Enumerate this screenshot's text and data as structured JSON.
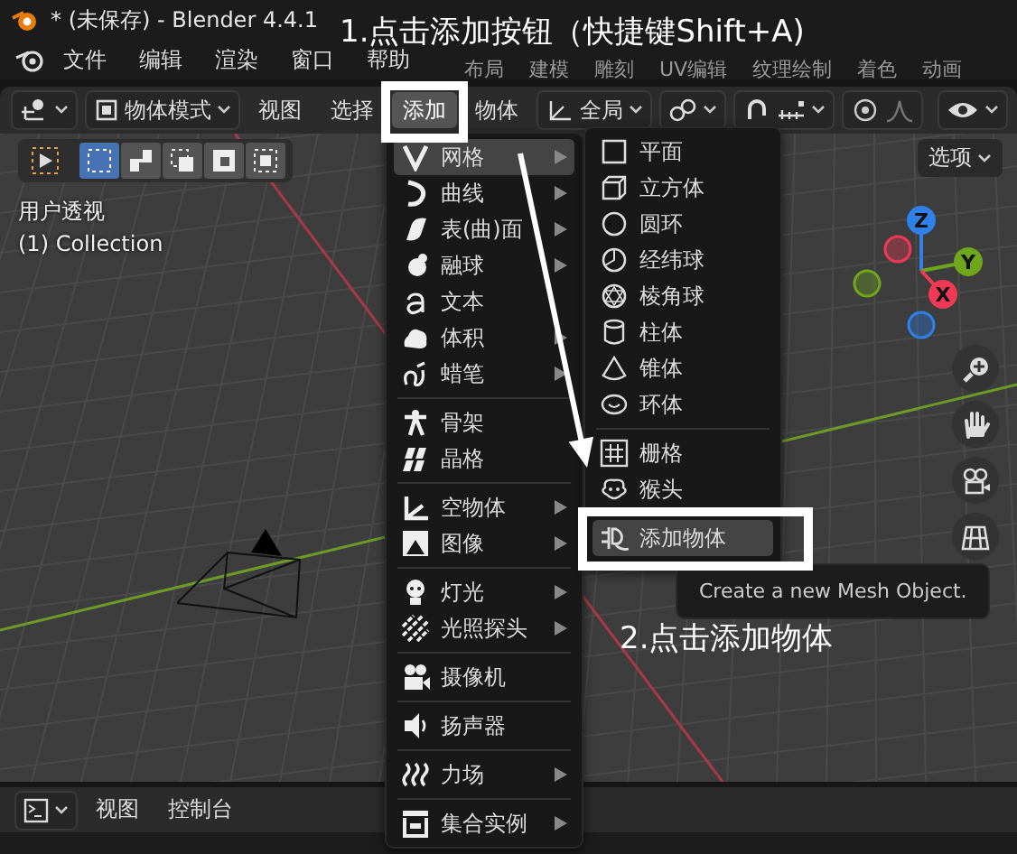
{
  "window": {
    "title": "* (未保存) - Blender 4.4.1"
  },
  "menubar": {
    "items": [
      "文件",
      "编辑",
      "渲染",
      "窗口",
      "帮助"
    ]
  },
  "workspace_tabs": [
    {
      "label": "布局",
      "selected": false
    },
    {
      "label": "建模",
      "selected": false
    },
    {
      "label": "雕刻",
      "selected": false
    },
    {
      "label": "UV编辑",
      "selected": false
    },
    {
      "label": "纹理绘制",
      "selected": false
    },
    {
      "label": "着色",
      "selected": false
    },
    {
      "label": "动画",
      "selected": false
    }
  ],
  "header": {
    "mode": "物体模式",
    "menus": [
      {
        "label": "视图",
        "selected": false
      },
      {
        "label": "选择",
        "selected": false
      },
      {
        "label": "添加",
        "selected": true
      },
      {
        "label": "物体",
        "selected": false
      }
    ],
    "orientation": "全局"
  },
  "viewport": {
    "view_name": "用户透视",
    "collection": "(1) Collection",
    "options": "选项",
    "gizmo_axes": [
      {
        "label": "Z",
        "color": "#2f80e8"
      },
      {
        "label": "Y",
        "color": "#6ea61c"
      },
      {
        "label": "X",
        "color": "#f03a55"
      }
    ]
  },
  "add_menu": {
    "sections": [
      [
        {
          "label": "网格",
          "has_submenu": true,
          "selected": true
        },
        {
          "label": "曲线",
          "has_submenu": true,
          "selected": false
        },
        {
          "label": "表(曲)面",
          "has_submenu": true,
          "selected": false
        },
        {
          "label": "融球",
          "has_submenu": true,
          "selected": false
        },
        {
          "label": "文本",
          "has_submenu": false,
          "selected": false
        },
        {
          "label": "体积",
          "has_submenu": true,
          "selected": false
        },
        {
          "label": "蜡笔",
          "has_submenu": true,
          "selected": false
        }
      ],
      [
        {
          "label": "骨架",
          "has_submenu": false,
          "selected": false
        },
        {
          "label": "晶格",
          "has_submenu": false,
          "selected": false
        }
      ],
      [
        {
          "label": "空物体",
          "has_submenu": true,
          "selected": false
        },
        {
          "label": "图像",
          "has_submenu": true,
          "selected": false
        }
      ],
      [
        {
          "label": "灯光",
          "has_submenu": true,
          "selected": false
        },
        {
          "label": "光照探头",
          "has_submenu": true,
          "selected": false
        }
      ],
      [
        {
          "label": "摄像机",
          "has_submenu": false,
          "selected": false
        }
      ],
      [
        {
          "label": "扬声器",
          "has_submenu": false,
          "selected": false
        }
      ],
      [
        {
          "label": "力场",
          "has_submenu": true,
          "selected": false
        }
      ],
      [
        {
          "label": "集合实例",
          "has_submenu": true,
          "selected": false
        }
      ]
    ]
  },
  "mesh_menu": {
    "sections": [
      [
        {
          "label": "平面",
          "selected": false
        },
        {
          "label": "立方体",
          "selected": false
        },
        {
          "label": "圆环",
          "selected": false
        },
        {
          "label": "经纬球",
          "selected": false
        },
        {
          "label": "棱角球",
          "selected": false
        },
        {
          "label": "柱体",
          "selected": false
        },
        {
          "label": "锥体",
          "selected": false
        },
        {
          "label": "环体",
          "selected": false
        }
      ],
      [
        {
          "label": "栅格",
          "selected": false
        },
        {
          "label": "猴头",
          "selected": false
        },
        {
          "label": "添加物体",
          "selected": true
        }
      ]
    ]
  },
  "tooltip": {
    "text": "Create a new Mesh Object."
  },
  "annotations": [
    {
      "text": "1.点击添加按钮（快捷键Shift+A)"
    },
    {
      "text": "2.点击添加物体"
    }
  ],
  "bottom_bar": {
    "menus": [
      "视图",
      "控制台"
    ]
  }
}
